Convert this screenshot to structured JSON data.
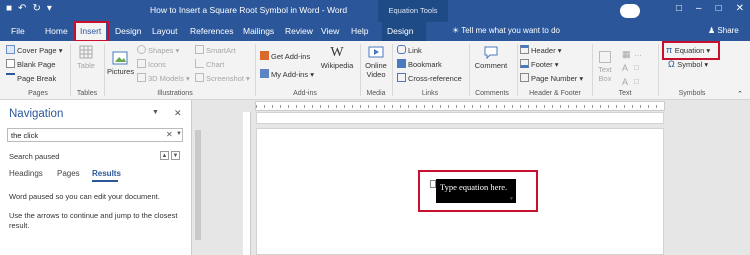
{
  "title_bar": {
    "title": "How to Insert a Square Root Symbol in Word  -  Word",
    "context_tab": "Equation Tools",
    "qat": [
      "■",
      "↶",
      "↻",
      "▾"
    ],
    "window_buttons": [
      "□",
      "–",
      "□",
      "✕"
    ]
  },
  "tabs": {
    "file": "File",
    "home": "Home",
    "insert": "Insert",
    "design": "Design",
    "layout": "Layout",
    "references": "References",
    "mailings": "Mailings",
    "review": "Review",
    "view": "View",
    "help": "Help",
    "design_eq": "Design",
    "tell_me": "Tell me what you want to do",
    "share": "Share"
  },
  "ribbon": {
    "pages": {
      "cover_page": "Cover Page",
      "blank_page": "Blank Page",
      "page_break": "Page Break",
      "label": "Pages"
    },
    "tables": {
      "table": "Table",
      "label": "Tables"
    },
    "illustrations": {
      "pictures": "Pictures",
      "shapes": "Shapes",
      "icons": "Icons",
      "models": "3D Models",
      "smartart": "SmartArt",
      "chart": "Chart",
      "screenshot": "Screenshot",
      "label": "Illustrations"
    },
    "addins": {
      "get": "Get Add-ins",
      "my": "My Add-ins",
      "wikipedia": "Wikipedia",
      "label": "Add-ins"
    },
    "media": {
      "online_video": "Online Video",
      "label": "Media"
    },
    "links": {
      "link": "Link",
      "bookmark": "Bookmark",
      "cross_ref": "Cross-reference",
      "label": "Links"
    },
    "comments": {
      "comment": "Comment",
      "label": "Comments"
    },
    "header_footer": {
      "header": "Header",
      "footer": "Footer",
      "page_number": "Page Number",
      "label": "Header & Footer"
    },
    "text": {
      "text_box": "Text Box",
      "label": "Text"
    },
    "symbols": {
      "equation": "Equation",
      "symbol": "Symbol",
      "label": "Symbols"
    }
  },
  "navigation": {
    "title": "Navigation",
    "search_value": "the click",
    "status": "Search paused",
    "tabs": [
      "Headings",
      "Pages",
      "Results"
    ],
    "message1": "Word paused so you can edit your document.",
    "message2": "Use the arrows to continue and jump to the closest result."
  },
  "document": {
    "equation_placeholder": "Type equation here."
  },
  "colors": {
    "accent": "#2b579a",
    "highlight": "#c8102e"
  }
}
